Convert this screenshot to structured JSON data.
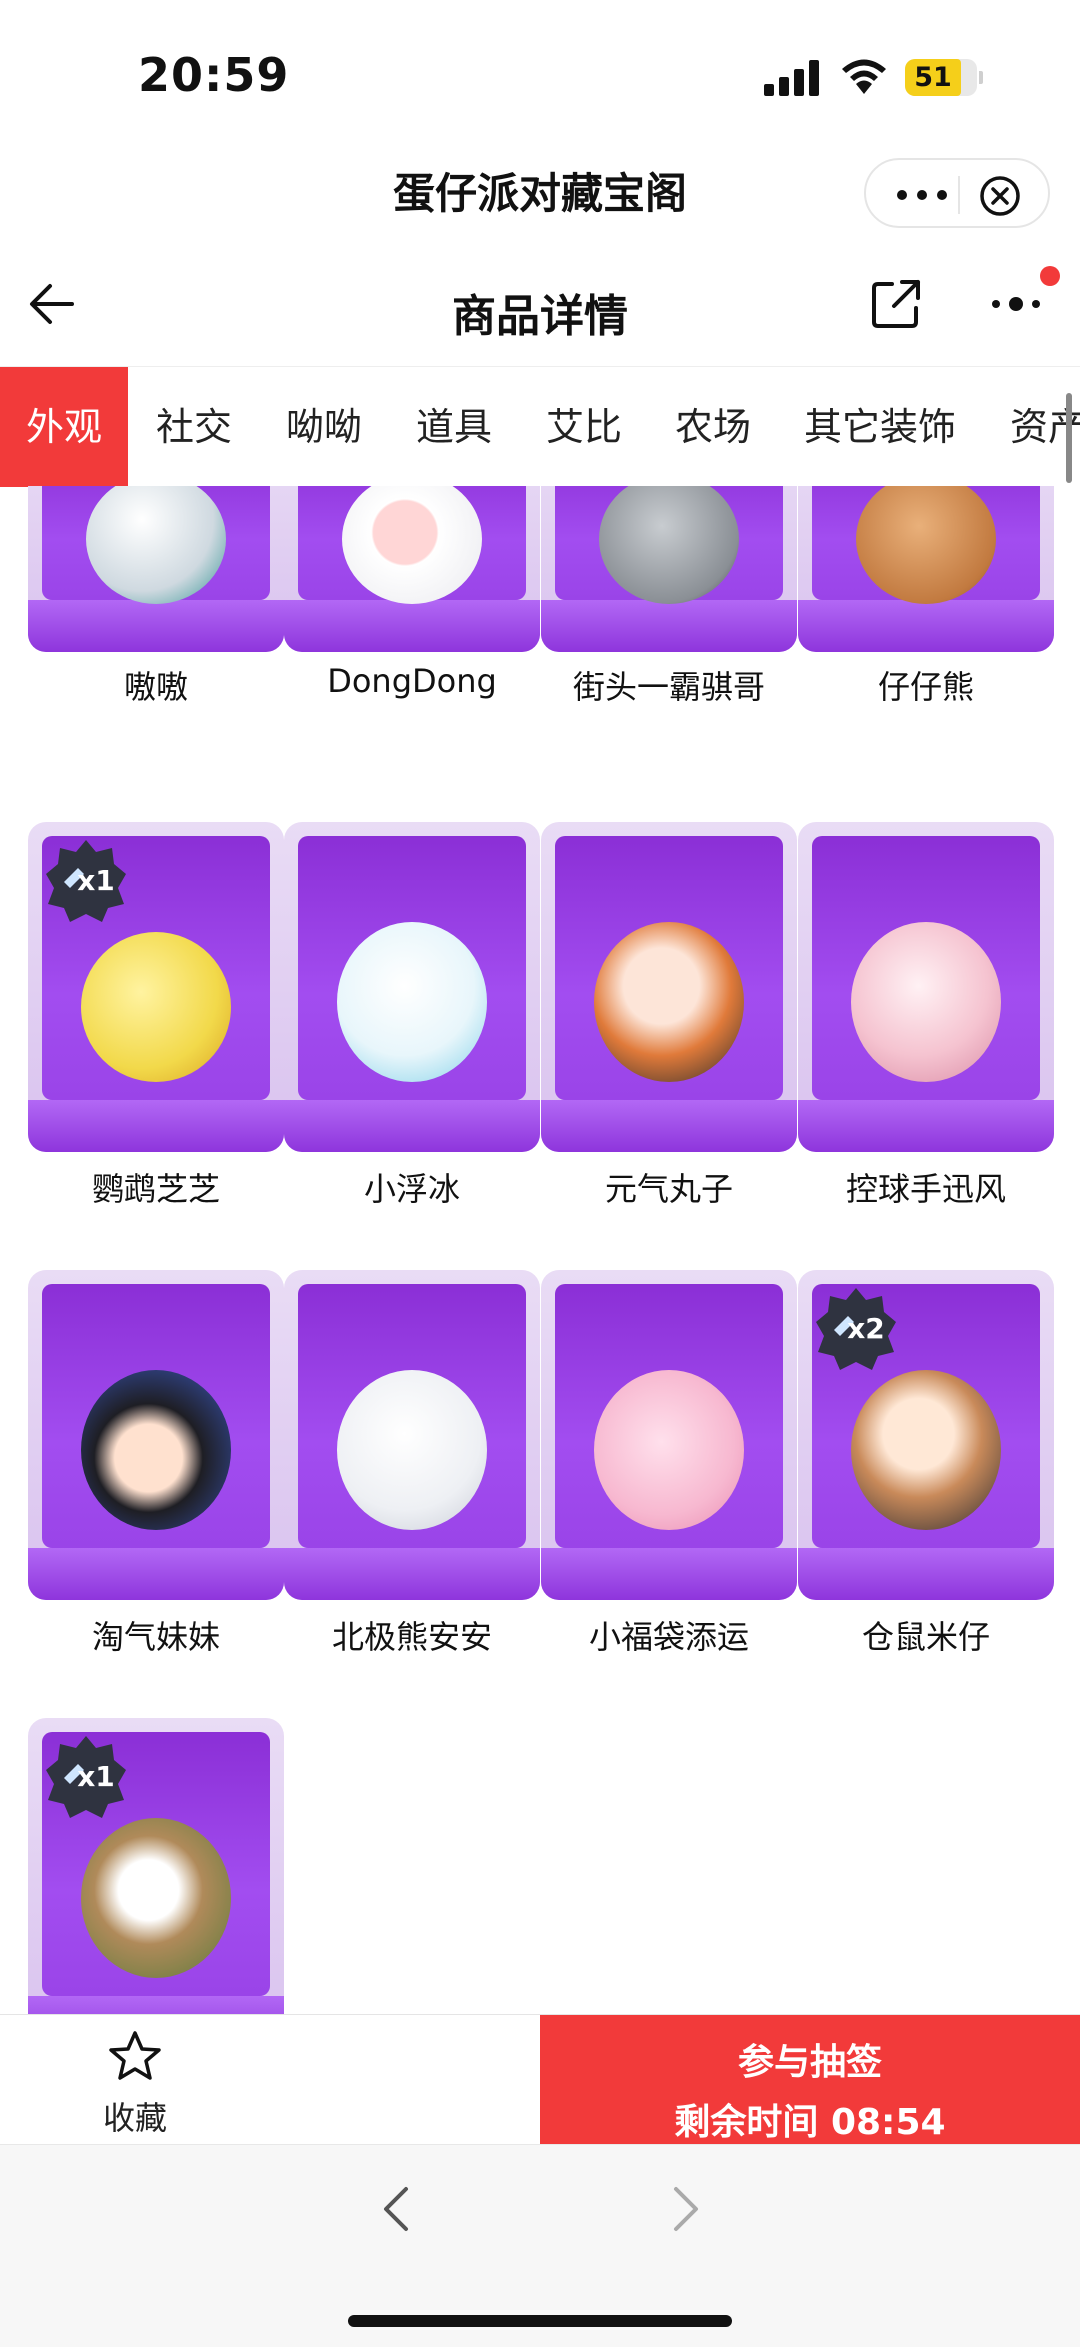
{
  "status_bar": {
    "time": "20:59",
    "battery": "51",
    "battery_color": "#f5cf1a"
  },
  "mini_program": {
    "title": "蛋仔派对藏宝阁",
    "icons": [
      "more-dots-icon",
      "close-circle-icon"
    ]
  },
  "nav": {
    "title": "商品详情",
    "icons": [
      "back-arrow-icon",
      "share-icon",
      "more-icon"
    ],
    "notification_dot_color": "#f23a3a"
  },
  "tabs": [
    {
      "label": "外观",
      "active": true
    },
    {
      "label": "社交"
    },
    {
      "label": "呦呦"
    },
    {
      "label": "道具"
    },
    {
      "label": "艾比"
    },
    {
      "label": "农场"
    },
    {
      "label": "其它装饰"
    },
    {
      "label": "资产"
    }
  ],
  "accent_color": "#f23a3a",
  "items": [
    {
      "name": "嗷嗷"
    },
    {
      "name": "DongDong"
    },
    {
      "name": "街头一霸骐哥"
    },
    {
      "name": "仔仔熊"
    },
    {
      "name": "鹦鹉芝芝",
      "badge": "x1"
    },
    {
      "name": "小浮冰"
    },
    {
      "name": "元气丸子"
    },
    {
      "name": "控球手迅风"
    },
    {
      "name": "淘气妹妹"
    },
    {
      "name": "北极熊安安"
    },
    {
      "name": "小福袋添运"
    },
    {
      "name": "仓鼠米仔",
      "badge": "x2"
    },
    {
      "name": "",
      "badge": "x1"
    }
  ],
  "bottom_bar": {
    "favorite_label": "收藏",
    "draw_line1": "参与抽签",
    "draw_line2": "剩余时间 08:54"
  }
}
